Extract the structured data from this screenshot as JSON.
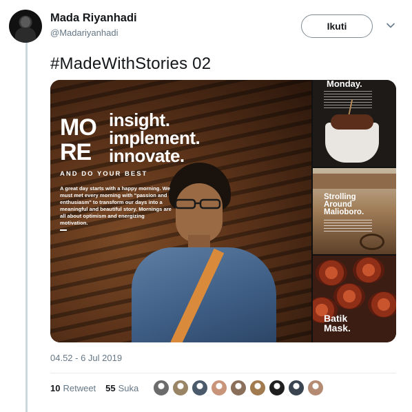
{
  "author": {
    "display_name": "Mada Riyanhadi",
    "handle": "@Madariyanhadi"
  },
  "actions": {
    "follow_label": "Ikuti"
  },
  "tweet": {
    "text": "#MadeWithStories 02",
    "timestamp": "04.52 - 6 Jul 2019"
  },
  "media": {
    "main": {
      "brand_line1": "MO",
      "brand_line2": "RE",
      "tagline_1": "insight.",
      "tagline_2": "implement.",
      "tagline_3": "innovate.",
      "subline": "AND DO YOUR BEST",
      "blurb": "A great day starts with a happy morning. We must met every morning with \"passion and enthusiasm\" to transform our days into a meaningful and beautiful story. Mornings are all about optimism and energizing motivation."
    },
    "thumb1_title": "Monday.",
    "thumb2_title_1": "Strolling",
    "thumb2_title_2": "Around",
    "thumb2_title_3": "Malioboro.",
    "thumb3_title_1": "Batik",
    "thumb3_title_2": "Mask."
  },
  "stats": {
    "retweet_count": "10",
    "retweet_label": "Retweet",
    "like_count": "55",
    "like_label": "Suka"
  },
  "likers": [
    {
      "icon": "avatar-icon",
      "color": "#6b6b6b"
    },
    {
      "icon": "avatar-icon",
      "color": "#9a8466"
    },
    {
      "icon": "avatar-icon",
      "color": "#4a5a6a"
    },
    {
      "icon": "avatar-icon",
      "color": "#c9957a"
    },
    {
      "icon": "avatar-icon",
      "color": "#8a6f5a"
    },
    {
      "icon": "avatar-icon",
      "color": "#a27a4f"
    },
    {
      "icon": "avatar-icon",
      "color": "#1e1e1e"
    },
    {
      "icon": "avatar-icon",
      "color": "#3a4450"
    },
    {
      "icon": "avatar-icon",
      "color": "#b58a73"
    }
  ]
}
